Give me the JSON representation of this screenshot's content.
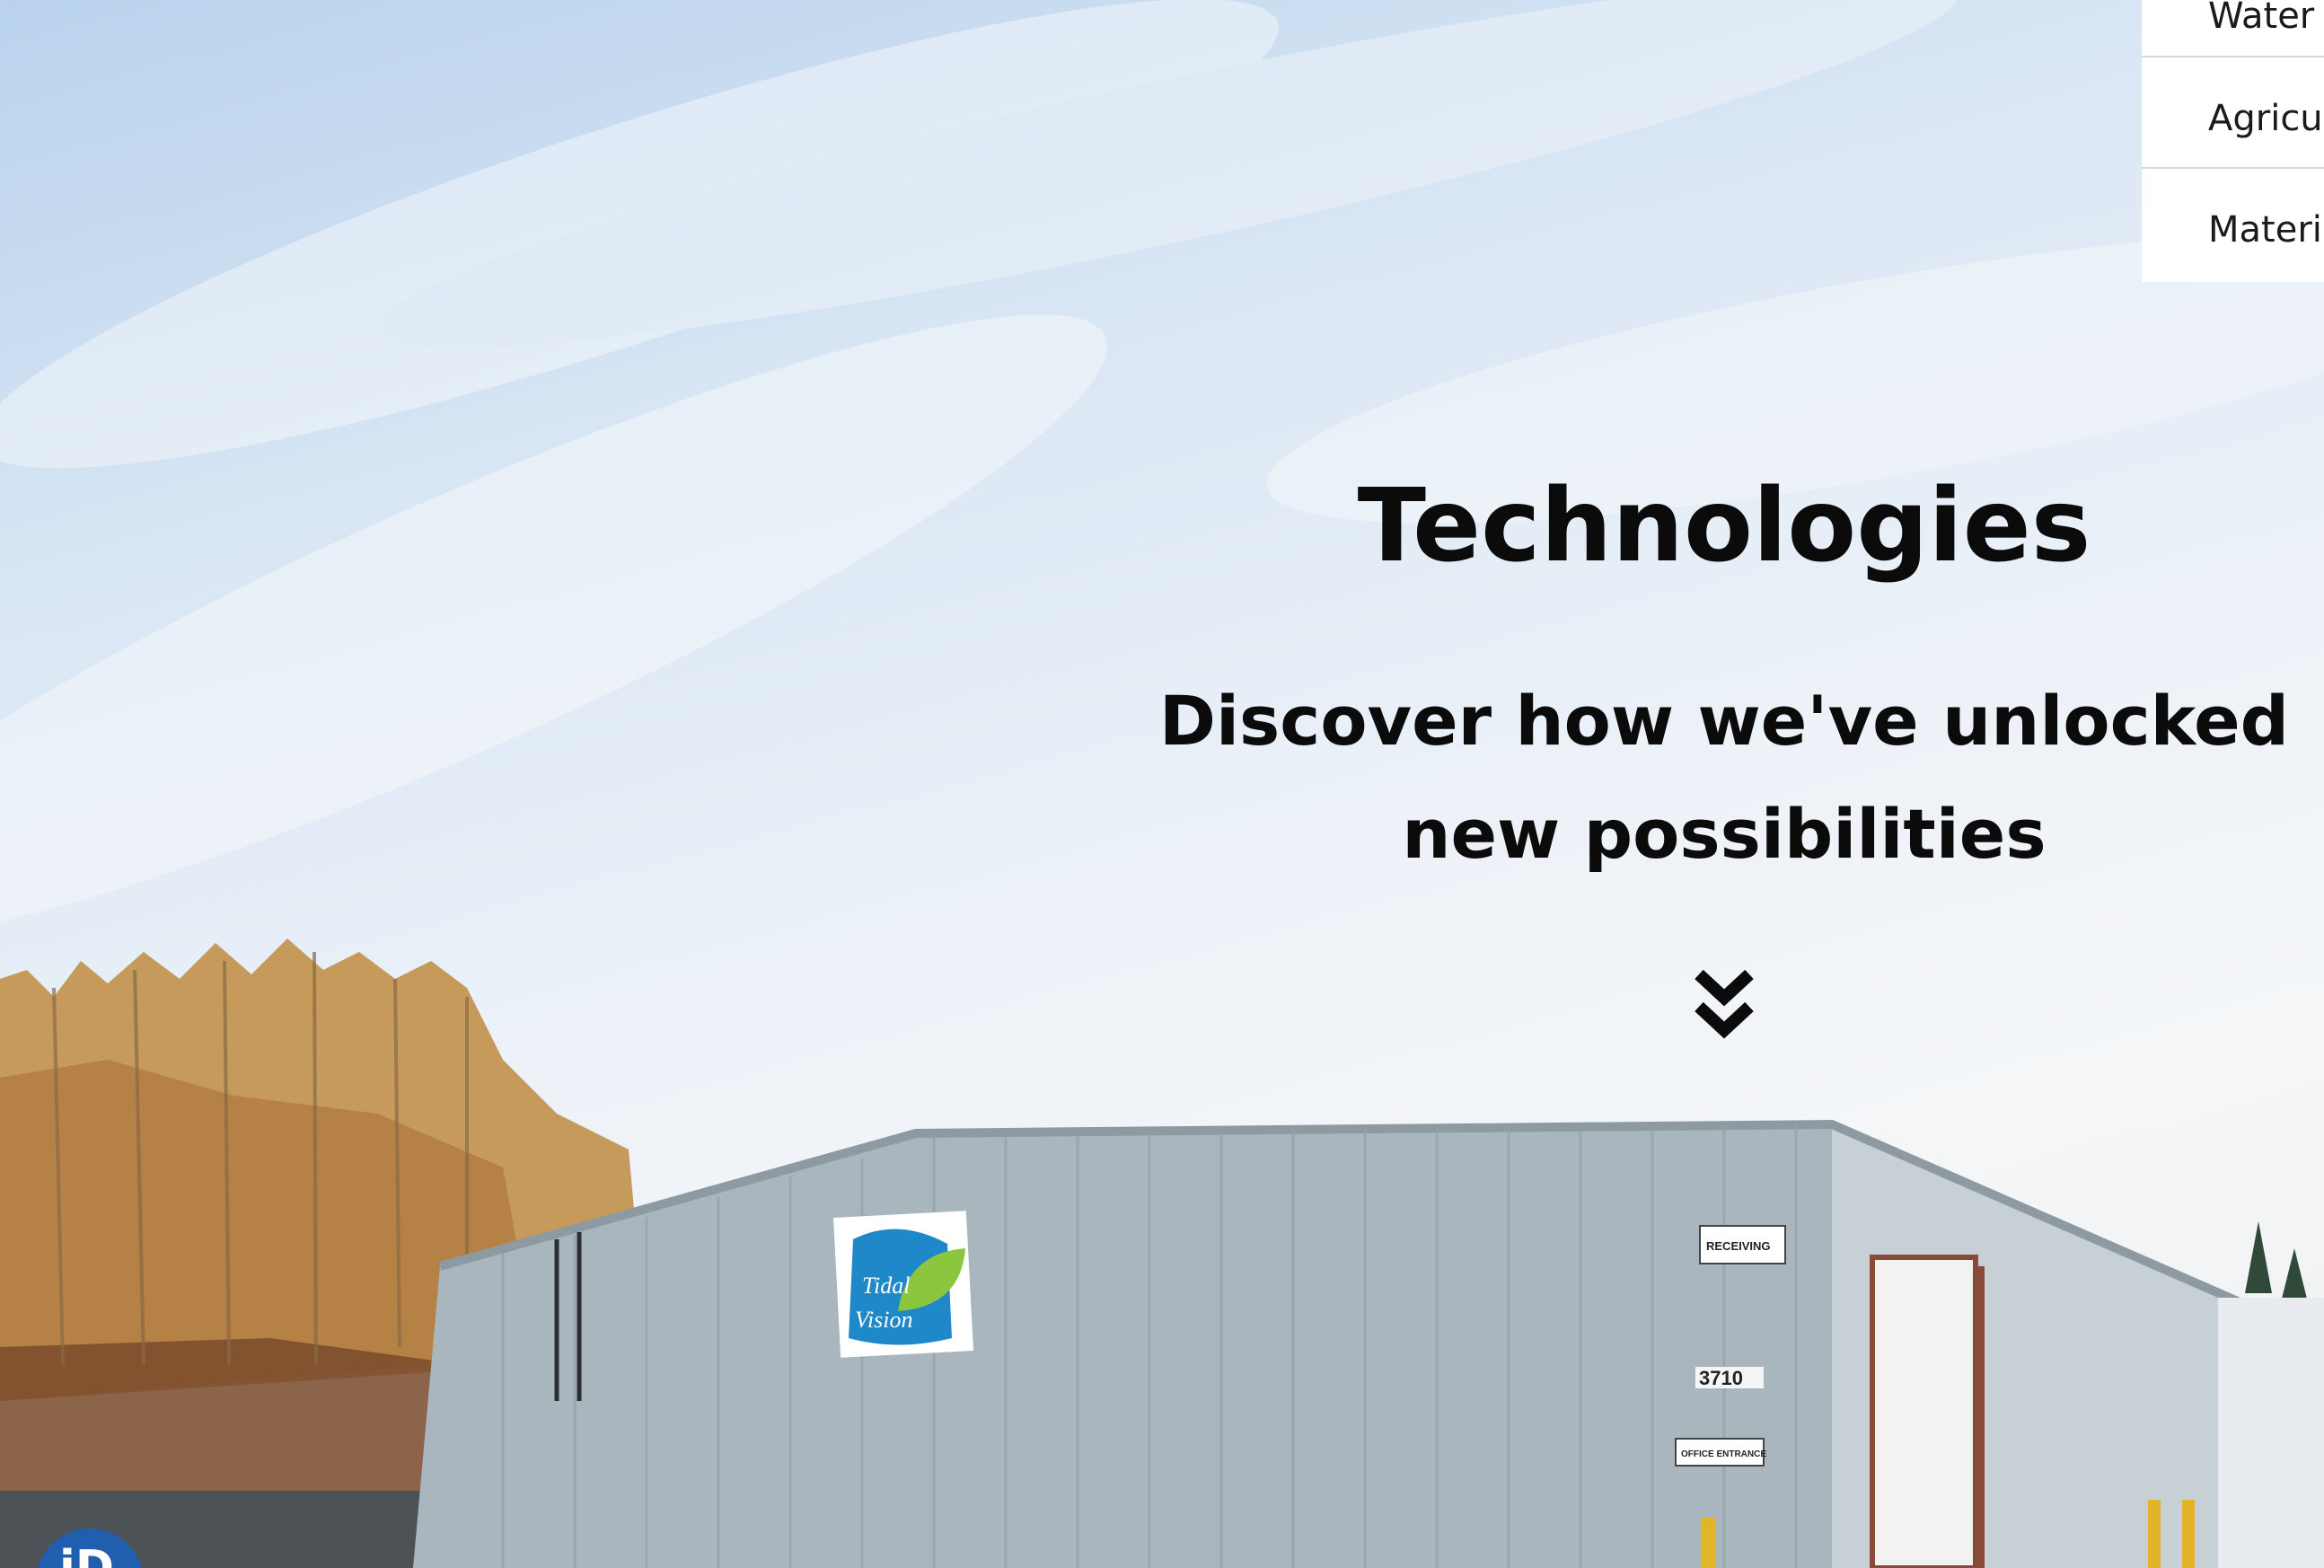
{
  "hero": {
    "title": "Technologies",
    "subtitle_line1": "Discover how we've unlocked",
    "subtitle_line2": "new possibilities",
    "scroll_icon": "chevron-double-down-icon"
  },
  "nav_dropdown": {
    "items": [
      {
        "label": "Water"
      },
      {
        "label": "Agriculture"
      },
      {
        "label": "Materials"
      }
    ]
  },
  "building": {
    "sign_logo_line1": "Tidal",
    "sign_logo_line2": "Vision",
    "receiving_sign": "RECEIVING",
    "address_number": "3710",
    "office_sign": "OFFICE ENTRANCE"
  },
  "accessibility_badge": {
    "icon": "accessibility-icon",
    "text": "iD"
  },
  "colors": {
    "sky_top": "#b9d2ec",
    "building_wall": "#a9b6bd",
    "heading_text": "#0b0b0b",
    "badge_blue": "#1f5fae",
    "logo_blue": "#1e88c9",
    "logo_green": "#8cc63f"
  }
}
